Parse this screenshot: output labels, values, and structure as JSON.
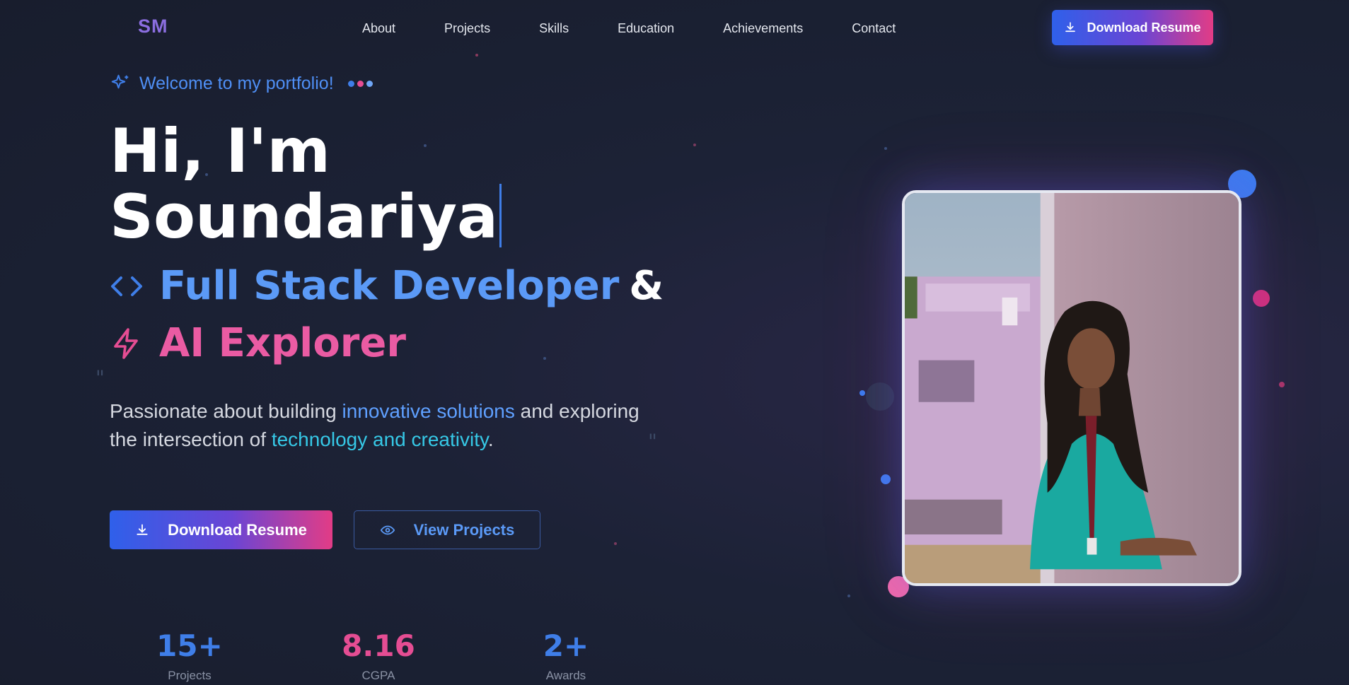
{
  "nav": {
    "logo": "SM",
    "links": [
      "About",
      "Projects",
      "Skills",
      "Education",
      "Achievements",
      "Contact"
    ],
    "download_label": "Download Resume"
  },
  "hero": {
    "welcome": "Welcome to my portfolio!",
    "greeting": "Hi, I'm",
    "name": "Soundariya",
    "role_primary": "Full Stack Developer",
    "role_amp": "&",
    "role_secondary": "AI Explorer",
    "desc_part1": "Passionate about building ",
    "desc_hl1": "innovative solutions",
    "desc_part2": " and exploring the intersection of ",
    "desc_hl2": "technology and creativity",
    "desc_part3": ".",
    "btn_download": "Download Resume",
    "btn_projects": "View Projects"
  },
  "stats": [
    {
      "value": "15+",
      "label": "Projects",
      "color": "#3f7ee8"
    },
    {
      "value": "8.16",
      "label": "CGPA",
      "color": "#e54d93"
    },
    {
      "value": "2+",
      "label": "Awards",
      "color": "#3f7ee8"
    }
  ],
  "colors": {
    "accent_blue": "#3f7ee8",
    "accent_pink": "#e54d93",
    "background": "#1c2236"
  },
  "icons": {
    "welcome": "sparkles-icon",
    "role_primary": "code-icon",
    "role_secondary": "zap-icon",
    "download": "download-icon",
    "view": "eye-icon"
  }
}
